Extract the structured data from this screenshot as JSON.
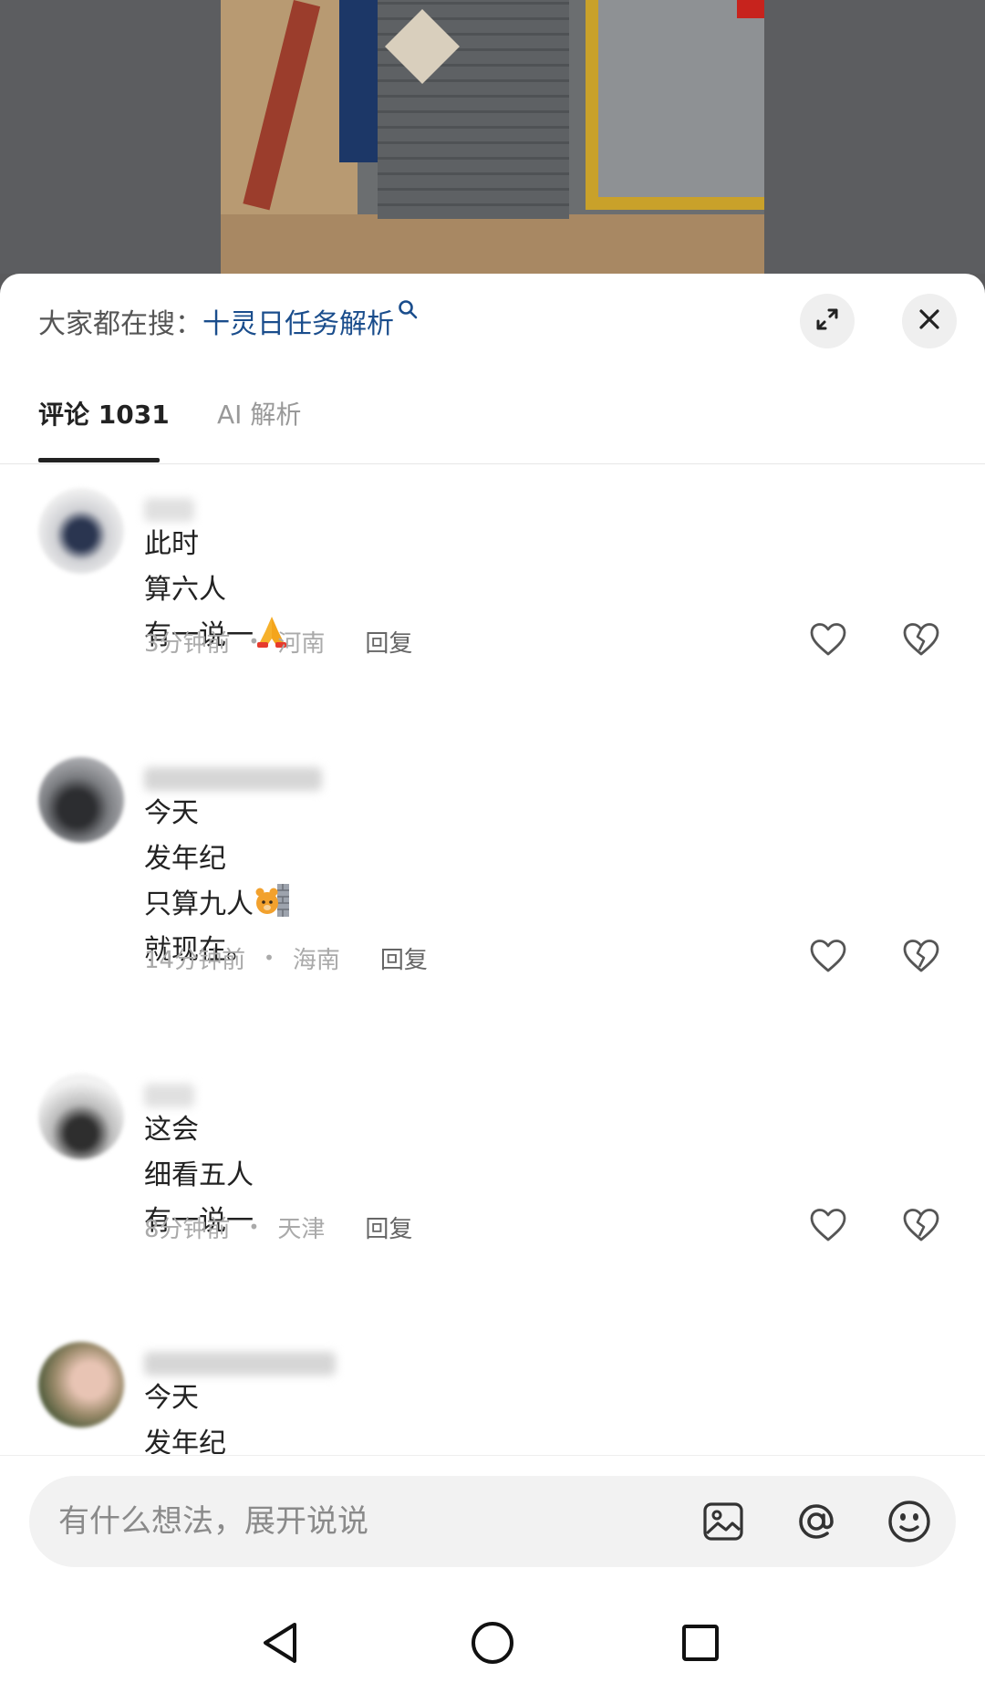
{
  "search_bar": {
    "prefix": "大家都在搜：",
    "term": "十灵日任务解析"
  },
  "tabs": {
    "comments_label": "评论 1031",
    "ai_label": "AI 解析"
  },
  "comments": [
    {
      "lines": [
        "此时",
        "算六人",
        "有一说一"
      ],
      "emoji": "folded-hands",
      "time": "3分钟前",
      "location": "河南",
      "reply_label": "回复"
    },
    {
      "lines": [
        "今天",
        "发年纪",
        "只算九人",
        "就现在。"
      ],
      "emoji": "bear-peeking-wall",
      "time": "14分钟前",
      "location": "海南",
      "reply_label": "回复"
    },
    {
      "lines": [
        "这会",
        "细看五人",
        "有一说一"
      ],
      "time": "8分钟前",
      "location": "天津",
      "reply_label": "回复"
    },
    {
      "lines": [
        "今天",
        "发年纪"
      ]
    }
  ],
  "input": {
    "placeholder": "有什么想法，展开说说"
  },
  "colors": {
    "search_term": "#1a4d8c",
    "tab_active": "#222222",
    "tab_inactive": "#999999",
    "meta_text": "#aaaaaa"
  },
  "icons": [
    "search-icon",
    "expand-icon",
    "close-icon",
    "heart-icon",
    "broken-heart-icon",
    "image-icon",
    "at-icon",
    "emoji-icon",
    "back-icon",
    "home-icon",
    "recent-apps-icon"
  ]
}
